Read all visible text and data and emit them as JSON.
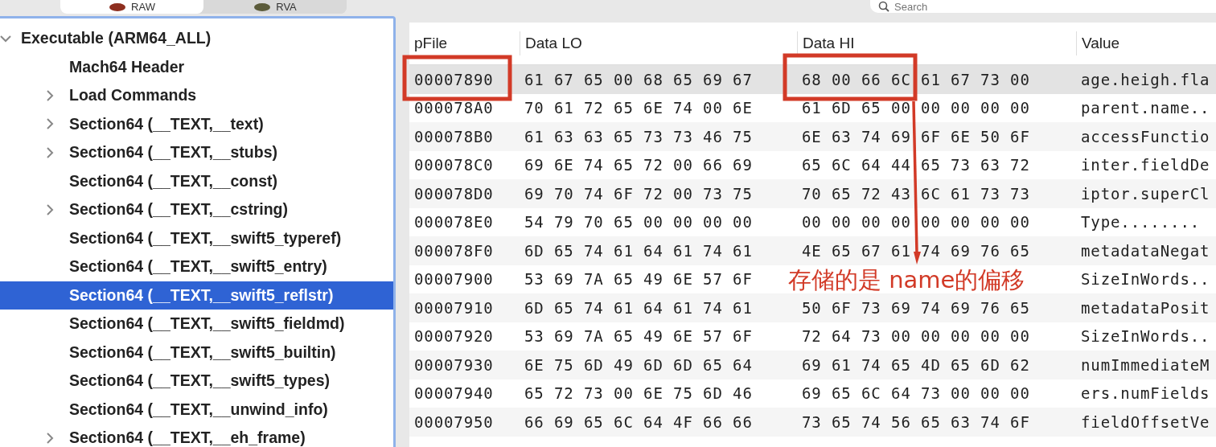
{
  "tabs": [
    {
      "label": "RAW",
      "selected": true
    },
    {
      "label": "RVA",
      "selected": false
    }
  ],
  "search": {
    "placeholder": "Search"
  },
  "tree": [
    {
      "label": "Executable  (ARM64_ALL)",
      "expanded": true,
      "selected": false,
      "children": [
        {
          "label": "Mach64 Header",
          "selected": false
        },
        {
          "label": "Load Commands",
          "expanded": false,
          "selected": false
        },
        {
          "label": "Section64 (__TEXT,__text)",
          "expanded": false,
          "selected": false
        },
        {
          "label": "Section64 (__TEXT,__stubs)",
          "expanded": false,
          "selected": false
        },
        {
          "label": "Section64 (__TEXT,__const)",
          "selected": false
        },
        {
          "label": "Section64 (__TEXT,__cstring)",
          "expanded": false,
          "selected": false
        },
        {
          "label": "Section64 (__TEXT,__swift5_typeref)",
          "selected": false
        },
        {
          "label": "Section64 (__TEXT,__swift5_entry)",
          "selected": false
        },
        {
          "label": "Section64 (__TEXT,__swift5_reflstr)",
          "selected": true
        },
        {
          "label": "Section64 (__TEXT,__swift5_fieldmd)",
          "selected": false
        },
        {
          "label": "Section64 (__TEXT,__swift5_builtin)",
          "selected": false
        },
        {
          "label": "Section64 (__TEXT,__swift5_types)",
          "selected": false
        },
        {
          "label": "Section64 (__TEXT,__unwind_info)",
          "selected": false
        },
        {
          "label": "Section64 (__TEXT,__eh_frame)",
          "expanded": false,
          "selected": false
        }
      ]
    }
  ],
  "table": {
    "columns": [
      "pFile",
      "Data LO",
      "Data HI",
      "Value"
    ],
    "rows": [
      {
        "pfile": "00007890",
        "data_lo": "61 67 65 00 68 65 69 67",
        "data_hi": "68 00 66 6C 61 67 73 00",
        "value": "age.heigh.fla",
        "selected": true
      },
      {
        "pfile": "000078A0",
        "data_lo": "70 61 72 65 6E 74 00 6E",
        "data_hi": "61 6D 65 00 00 00 00 00",
        "value": "parent.name..",
        "selected": false
      },
      {
        "pfile": "000078B0",
        "data_lo": "61 63 63 65 73 73 46 75",
        "data_hi": "6E 63 74 69 6F 6E 50 6F",
        "value": "accessFunctio",
        "selected": false
      },
      {
        "pfile": "000078C0",
        "data_lo": "69 6E 74 65 72 00 66 69",
        "data_hi": "65 6C 64 44 65 73 63 72",
        "value": "inter.fieldDe",
        "selected": false
      },
      {
        "pfile": "000078D0",
        "data_lo": "69 70 74 6F 72 00 73 75",
        "data_hi": "70 65 72 43 6C 61 73 73",
        "value": "iptor.superCl",
        "selected": false
      },
      {
        "pfile": "000078E0",
        "data_lo": "54 79 70 65 00 00 00 00",
        "data_hi": "00 00 00 00 00 00 00 00",
        "value": "Type........",
        "selected": false
      },
      {
        "pfile": "000078F0",
        "data_lo": "6D 65 74 61 64 61 74 61",
        "data_hi": "4E 65 67 61 74 69 76 65",
        "value": "metadataNegat",
        "selected": false
      },
      {
        "pfile": "00007900",
        "data_lo": "53 69 7A 65 49 6E 57 6F",
        "value": "SizeInWords..",
        "selected": false
      },
      {
        "pfile": "00007910",
        "data_lo": "6D 65 74 61 64 61 74 61",
        "data_hi": "50 6F 73 69 74 69 76 65",
        "value": "metadataPosit",
        "selected": false
      },
      {
        "pfile": "00007920",
        "data_lo": "53 69 7A 65 49 6E 57 6F",
        "data_hi": "72 64 73 00 00 00 00 00",
        "value": "SizeInWords..",
        "selected": false
      },
      {
        "pfile": "00007930",
        "data_lo": "6E 75 6D 49 6D 6D 65 64",
        "data_hi": "69 61 74 65 4D 65 6D 62",
        "value": "numImmediateM",
        "selected": false
      },
      {
        "pfile": "00007940",
        "data_lo": "65 72 73 00 6E 75 6D 46",
        "data_hi": "69 65 6C 64 73 00 00 00",
        "value": "ers.numFields",
        "selected": false
      },
      {
        "pfile": "00007950",
        "data_lo": "66 69 65 6C 64 4F 66 66",
        "data_hi": "73 65 74 56 65 63 74 6F",
        "value": "fieldOffsetVe",
        "selected": false
      }
    ]
  },
  "annotation": {
    "note": "存储的是 name的偏移"
  }
}
